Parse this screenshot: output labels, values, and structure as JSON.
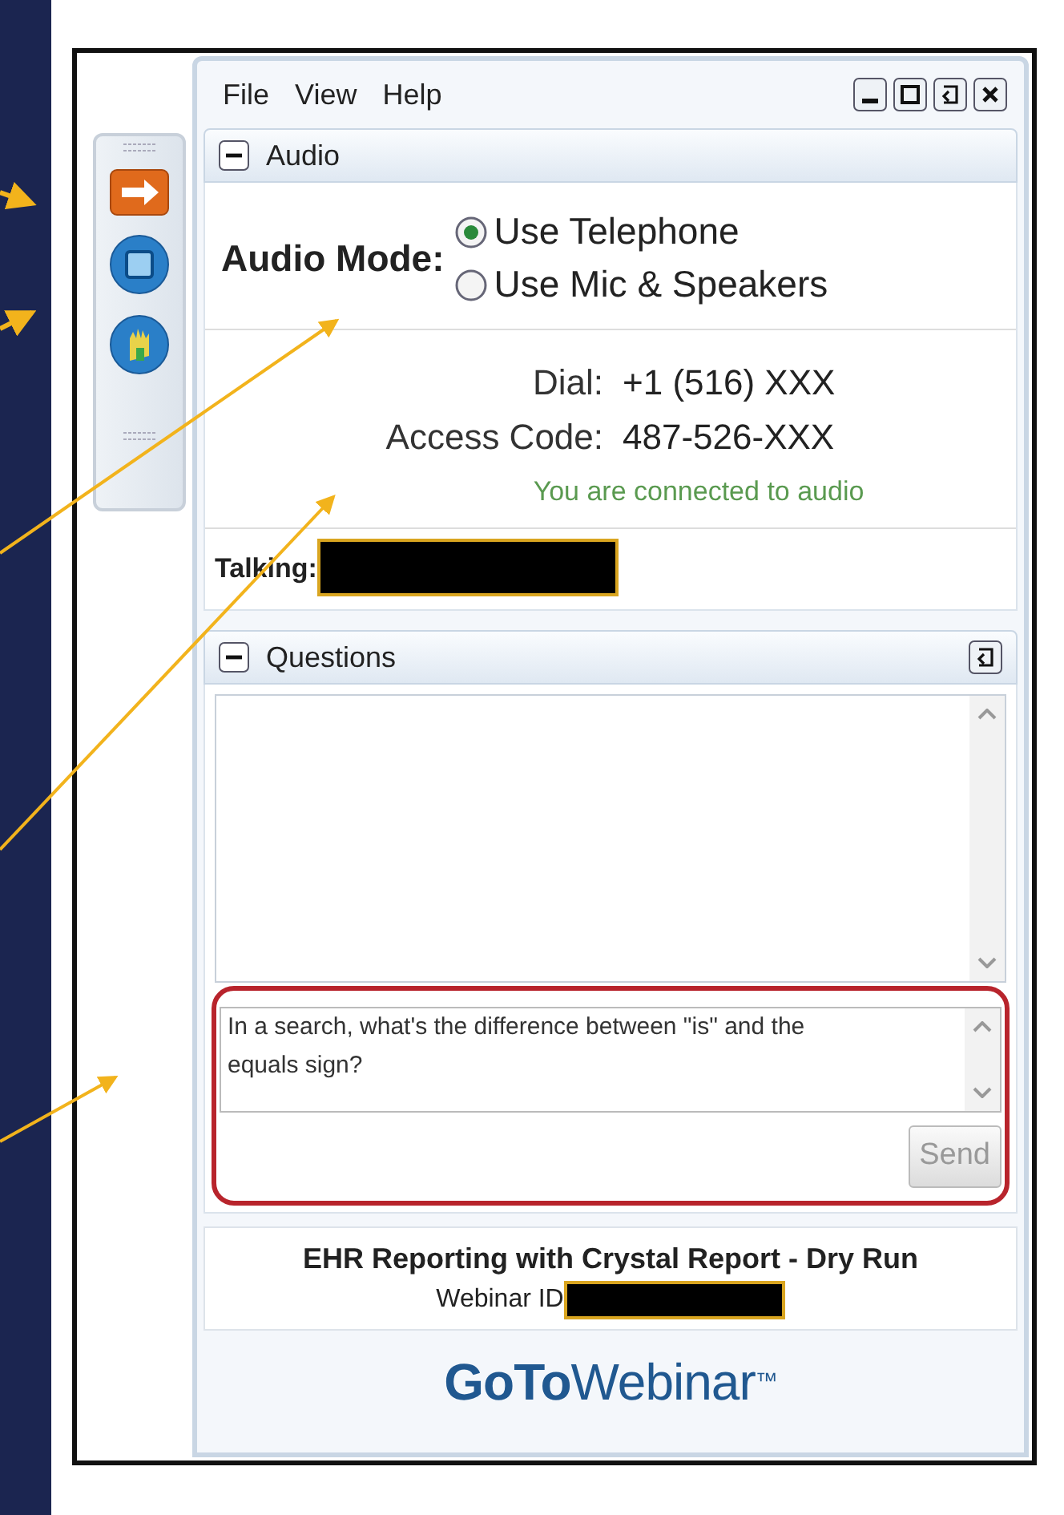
{
  "menu": [
    "File",
    "View",
    "Help"
  ],
  "audio": {
    "title": "Audio",
    "expanded": true,
    "mode_label": "Audio Mode:",
    "options": [
      {
        "label": "Use Telephone",
        "selected": true
      },
      {
        "label": "Use Mic & Speakers",
        "selected": false
      }
    ],
    "dial_label": "Dial:",
    "dial": "+1 (516) XXX",
    "access_label": "Access Code:",
    "access_code": "487-526-XXX",
    "status": "You are connected to audio",
    "talking_label": "Talking:"
  },
  "questions": {
    "title": "Questions",
    "expanded": true,
    "question": "In a search, what's the difference between \"is\" and the equals sign?",
    "send": "Send"
  },
  "webinar": {
    "title": "EHR Reporting with Crystal Report - Dry Run",
    "id_label": "Webinar ID"
  },
  "brand": "**GoTo**Webinar$^{™}$"
}
